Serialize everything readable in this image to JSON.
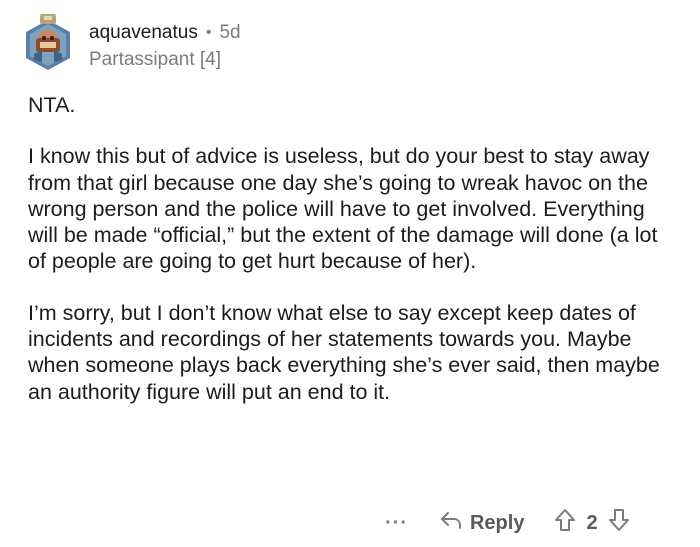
{
  "comment": {
    "username": "aquavenatus",
    "separator": "•",
    "age": "5d",
    "flair": "Partassipant [4]",
    "paragraphs": [
      "NTA.",
      "I know this but of advice is useless, but do your best to stay away from that girl because one day she’s going to wreak havoc on the wrong person and the police will have to get involved. Everything will be made “official,” but the extent of the damage will done (a lot of people are going to get hurt because of her).",
      "I’m sorry, but I don’t know what else to say except keep dates of incidents and recordings of her statements towards you. Maybe when someone plays back everything she’s ever said, then maybe an authority figure will put an end to it."
    ]
  },
  "actions": {
    "more_label": "···",
    "reply_label": "Reply",
    "score": "2",
    "icons": [
      "reply-arrow-icon",
      "upvote-icon",
      "downvote-icon"
    ]
  },
  "colors": {
    "text": "#1c1c1c",
    "meta": "#7c7c7c",
    "avatar_bg": "#5b7fa6"
  }
}
